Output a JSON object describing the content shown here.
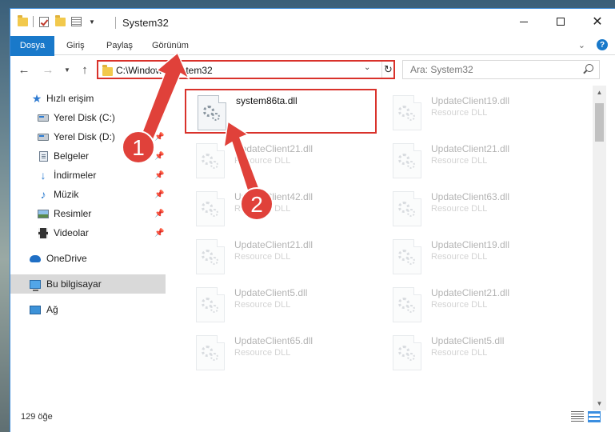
{
  "window": {
    "title": "System32"
  },
  "ribbon": {
    "tabs": [
      {
        "label": "Dosya"
      },
      {
        "label": "Giriş"
      },
      {
        "label": "Paylaş"
      },
      {
        "label": "Görünüm"
      }
    ]
  },
  "navigation": {
    "address": "C:\\Windows\\System32",
    "search_placeholder": "Ara: System32"
  },
  "sidebar": {
    "items": [
      {
        "label": "Hızlı erişim",
        "icon": "star-icon"
      },
      {
        "label": "Yerel Disk (C:)",
        "icon": "disk-icon"
      },
      {
        "label": "Yerel Disk (D:)",
        "icon": "disk-icon"
      },
      {
        "label": "Belgeler",
        "icon": "documents-icon"
      },
      {
        "label": "İndirmeler",
        "icon": "downloads-icon"
      },
      {
        "label": "Müzik",
        "icon": "music-icon"
      },
      {
        "label": "Resimler",
        "icon": "pictures-icon"
      },
      {
        "label": "Videolar",
        "icon": "videos-icon"
      },
      {
        "label": "OneDrive",
        "icon": "onedrive-icon"
      },
      {
        "label": "Bu bilgisayar",
        "icon": "computer-icon",
        "selected": true
      },
      {
        "label": "Ağ",
        "icon": "network-icon"
      }
    ]
  },
  "files": [
    {
      "name": "system86ta.dll",
      "type": ""
    },
    {
      "name": "UpdateClient19.dll",
      "type": "Resource DLL"
    },
    {
      "name": "UpdateClient21.dll",
      "type": "Resource DLL"
    },
    {
      "name": "UpdateClient21.dll",
      "type": "Resource DLL"
    },
    {
      "name": "UpdateClient42.dll",
      "type": "Resource DLL"
    },
    {
      "name": "UpdateClient63.dll",
      "type": "Resource DLL"
    },
    {
      "name": "UpdateClient21.dll",
      "type": "Resource DLL"
    },
    {
      "name": "UpdateClient19.dll",
      "type": "Resource DLL"
    },
    {
      "name": "UpdateClient5.dll",
      "type": "Resource DLL"
    },
    {
      "name": "UpdateClient21.dll",
      "type": "Resource DLL"
    },
    {
      "name": "UpdateClient65.dll",
      "type": "Resource DLL"
    },
    {
      "name": "UpdateClient5.dll",
      "type": "Resource DLL"
    }
  ],
  "status": {
    "item_count": "129 öğe"
  },
  "annotations": {
    "marker_1": "1",
    "marker_2": "2",
    "color": "#e0413a"
  }
}
